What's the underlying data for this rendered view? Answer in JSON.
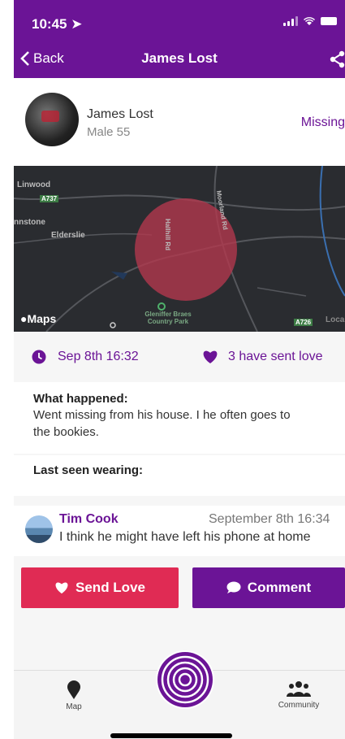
{
  "status": {
    "time": "10:45"
  },
  "nav": {
    "back_label": "Back",
    "title": "James Lost"
  },
  "profile": {
    "name": "James Lost",
    "details": "Male 55",
    "status": "Missing"
  },
  "map": {
    "labels": {
      "linwood": "Linwood",
      "road_a737": "A737",
      "johnstone": "nnstone",
      "elderslie": "Elderslie",
      "road_west": "Hallhill Rd",
      "road_east": "Moorland Rd",
      "park": "Gleniffer Braes Country Park",
      "road_a726": "A726",
      "local": "Local"
    },
    "badge": "Maps"
  },
  "info": {
    "date": "Sep 8th 16:32",
    "love_count": "3 have sent love"
  },
  "sections": {
    "what_happened": {
      "title": "What happened:",
      "line1": "Went missing from his house. I he often goes to",
      "line2": "the bookies."
    },
    "last_seen": {
      "title": "Last seen wearing:"
    }
  },
  "comment": {
    "author": "Tim Cook",
    "date": "September 8th 16:34",
    "text": "I think he might have left his phone at home"
  },
  "buttons": {
    "send_love": "Send Love",
    "comment": "Comment"
  },
  "tabbar": {
    "map": "Map",
    "community": "Community"
  },
  "colors": {
    "brand": "#6b1496",
    "love": "#e02b54"
  }
}
